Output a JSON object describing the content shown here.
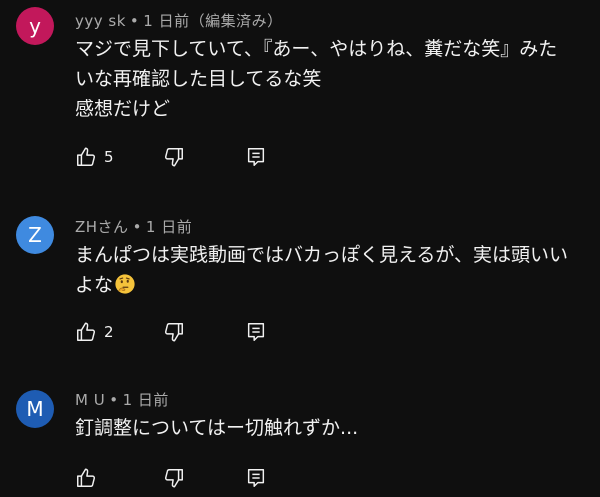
{
  "colors": {
    "background": "#0f0f0f",
    "text_primary": "#f1f1f1",
    "text_secondary": "#aaaaaa"
  },
  "comments": [
    {
      "avatar_letter": "y",
      "avatar_color": "#c2185b",
      "author": "yyy sk",
      "separator": "•",
      "time": "1 日前（編集済み）",
      "lines": [
        "マジで見下していて、『あー、やはりね、糞だな笑』みた",
        "いな再確認した目してるな笑",
        "感想だけど"
      ],
      "likes": "5"
    },
    {
      "avatar_letter": "Z",
      "avatar_color": "#3f8ae0",
      "author": "ZHさん",
      "separator": "•",
      "time": "1 日前",
      "lines": [
        "まんぱつは実践動画ではバカっぽく見えるが、実は頭いい",
        "よな"
      ],
      "emoji": "thinking-face",
      "likes": "2"
    },
    {
      "avatar_letter": "M",
      "avatar_color": "#1e5cb3",
      "author": "M U",
      "separator": "•",
      "time": "1 日前",
      "lines": [
        "釘調整についてはー切触れずか..."
      ],
      "likes": ""
    }
  ]
}
